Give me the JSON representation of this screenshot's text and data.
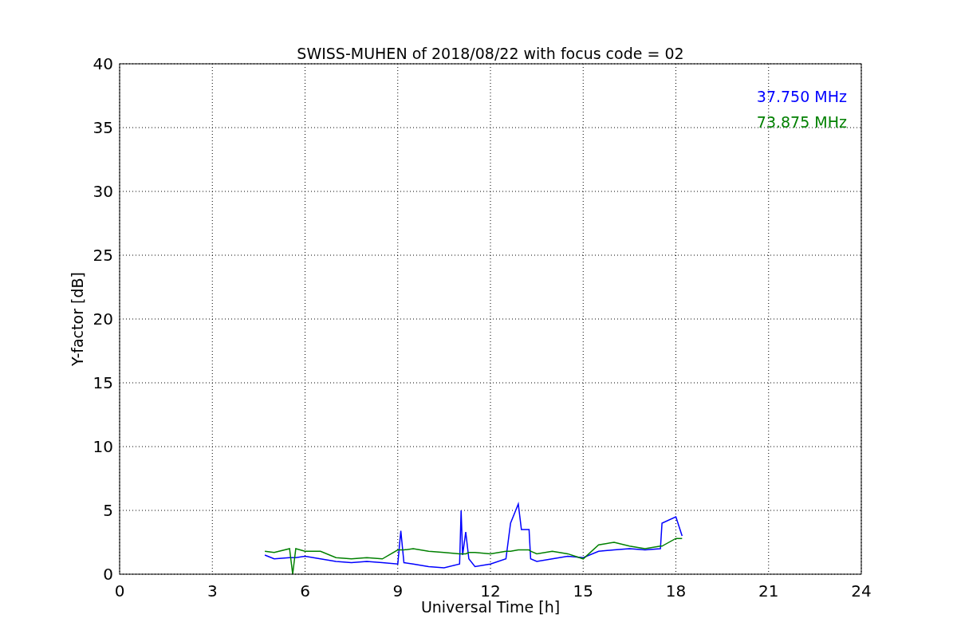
{
  "chart_data": {
    "type": "line",
    "title": "SWISS-MUHEN of 2018/08/22 with focus code = 02",
    "xlabel": "Universal Time [h]",
    "ylabel": "Y-factor [dB]",
    "x": [
      4.7,
      5,
      5.5,
      5.6,
      5.7,
      6,
      6.5,
      7,
      7.5,
      8,
      8.5,
      9,
      9.1,
      9.2,
      9.5,
      10,
      10.5,
      11,
      11.05,
      11.1,
      11.2,
      11.3,
      11.5,
      12,
      12.5,
      12.65,
      12.9,
      13,
      13.25,
      13.3,
      13.5,
      14,
      14.5,
      15,
      15.5,
      16,
      16.5,
      17,
      17.5,
      17.55,
      18,
      18.2
    ],
    "series": [
      {
        "name": "37.750 MHz",
        "color": "#0000ff",
        "values": [
          1.5,
          1.2,
          1.3,
          1.3,
          1.3,
          1.4,
          1.2,
          1.0,
          0.9,
          1.0,
          0.9,
          0.8,
          3.4,
          0.9,
          0.8,
          0.6,
          0.5,
          0.8,
          5.0,
          1.5,
          3.3,
          1.2,
          0.6,
          0.8,
          1.2,
          4.0,
          5.5,
          3.5,
          3.5,
          1.2,
          1.0,
          1.2,
          1.4,
          1.3,
          1.8,
          1.9,
          2.0,
          1.9,
          2.0,
          4.0,
          4.5,
          3.0
        ]
      },
      {
        "name": "73.875 MHz",
        "color": "#008000",
        "values": [
          1.8,
          1.7,
          2.0,
          0,
          2.0,
          1.8,
          1.8,
          1.3,
          1.2,
          1.3,
          1.2,
          1.9,
          1.9,
          1.9,
          2.0,
          1.8,
          1.7,
          1.6,
          1.6,
          1.6,
          1.6,
          1.7,
          1.7,
          1.6,
          1.8,
          1.8,
          1.9,
          1.9,
          1.9,
          1.8,
          1.6,
          1.8,
          1.6,
          1.2,
          2.3,
          2.5,
          2.2,
          2.0,
          2.2,
          2.2,
          2.8,
          2.8
        ]
      }
    ],
    "xlim": [
      0,
      24
    ],
    "ylim": [
      0,
      40
    ],
    "xticks": [
      0,
      3,
      6,
      9,
      12,
      15,
      18,
      21,
      24
    ],
    "yticks": [
      0,
      5,
      10,
      15,
      20,
      25,
      30,
      35,
      40
    ],
    "grid": true
  }
}
